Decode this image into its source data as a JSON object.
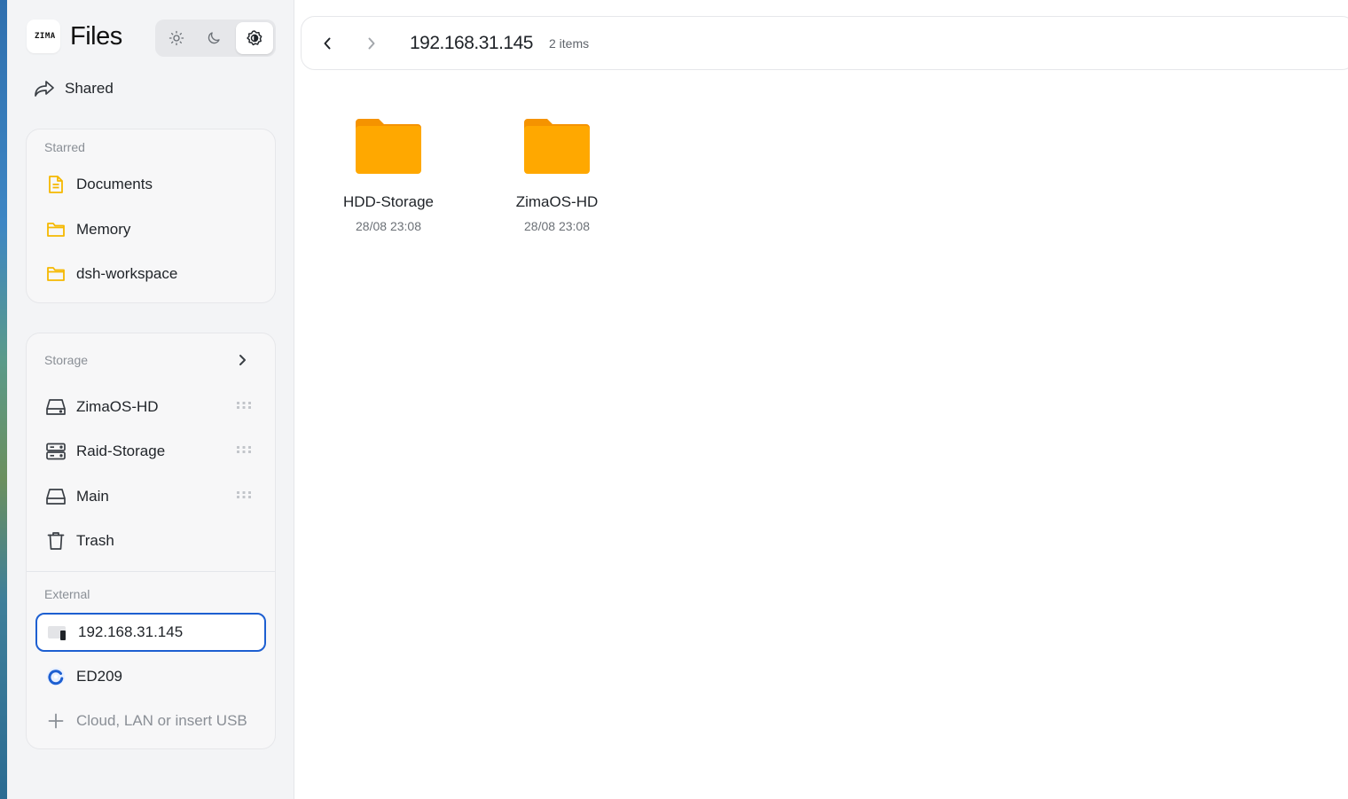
{
  "app": {
    "logo_text": "ZIMA",
    "title": "Files"
  },
  "theme_switcher": {
    "options": [
      "light",
      "dark",
      "system"
    ],
    "active": "system"
  },
  "sidebar": {
    "shared_label": "Shared",
    "starred": {
      "label": "Starred",
      "items": [
        {
          "label": "Documents",
          "icon": "document-icon"
        },
        {
          "label": "Memory",
          "icon": "folder-icon"
        },
        {
          "label": "dsh-workspace",
          "icon": "folder-icon"
        }
      ]
    },
    "storage": {
      "label": "Storage",
      "items": [
        {
          "label": "ZimaOS-HD",
          "icon": "drive-icon"
        },
        {
          "label": "Raid-Storage",
          "icon": "raid-icon"
        },
        {
          "label": "Main",
          "icon": "drive-icon"
        },
        {
          "label": "Trash",
          "icon": "trash-icon"
        }
      ]
    },
    "external": {
      "label": "External",
      "items": [
        {
          "label": "192.168.31.145",
          "icon": "network-share-icon",
          "selected": true
        },
        {
          "label": "ED209",
          "icon": "cloud-sync-icon"
        }
      ],
      "add_label": "Cloud, LAN or insert USB"
    }
  },
  "toolbar": {
    "path": "192.168.31.145",
    "item_count": "2 items"
  },
  "files": [
    {
      "name": "HDD-Storage",
      "date": "28/08 23:08",
      "icon": "folder-icon"
    },
    {
      "name": "ZimaOS-HD",
      "date": "28/08 23:08",
      "icon": "folder-icon"
    }
  ],
  "colors": {
    "accent": "#1d5fd1",
    "folder": "#ffa800",
    "folder_tab": "#f59300",
    "starred_icon": "#f5b800"
  }
}
